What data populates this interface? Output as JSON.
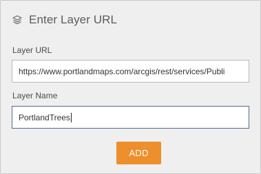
{
  "dialog": {
    "title": "Enter Layer URL",
    "icon": "layers-icon"
  },
  "layer_url": {
    "label": "Layer URL",
    "value": "https://www.portlandmaps.com/arcgis/rest/services/Publi"
  },
  "layer_name": {
    "label": "Layer Name",
    "value": "PortlandTrees"
  },
  "add_button": {
    "label": "ADD",
    "color": "#ec8f2c"
  }
}
